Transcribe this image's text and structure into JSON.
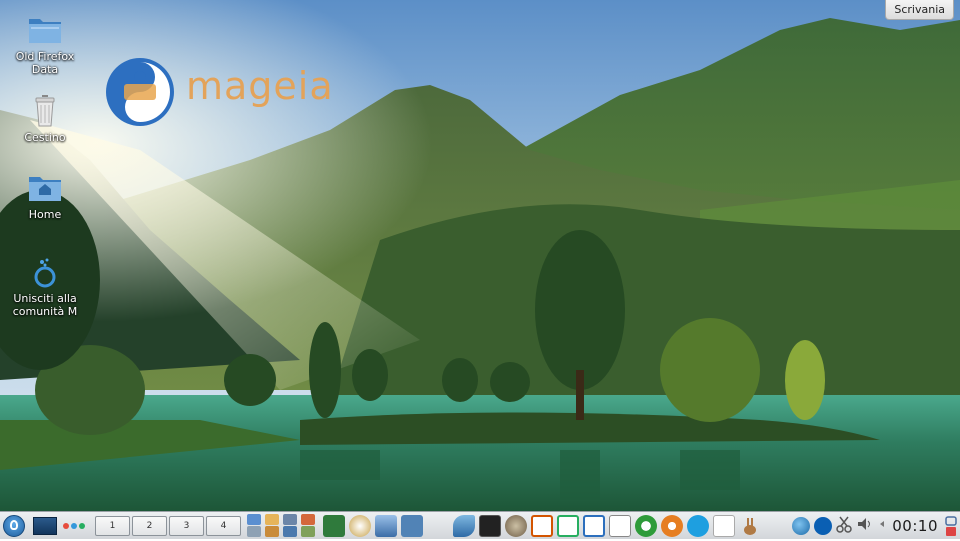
{
  "cashew": {
    "label": "Scrivania"
  },
  "desktop_icons": [
    {
      "name": "folder-icon",
      "label": "Old Firefox Data"
    },
    {
      "name": "trash-icon",
      "label": "Cestino"
    },
    {
      "name": "home-folder-icon",
      "label": "Home"
    },
    {
      "name": "mageia-community-icon",
      "label": "Unisciti alla comunità M"
    }
  ],
  "logo": {
    "text": "mageia"
  },
  "panel": {
    "desktops": [
      "1",
      "2",
      "3",
      "4"
    ],
    "clock": "00:10",
    "colors": {
      "panel_bg": "#dfe2e5",
      "accent": "#1f5d9c"
    }
  }
}
